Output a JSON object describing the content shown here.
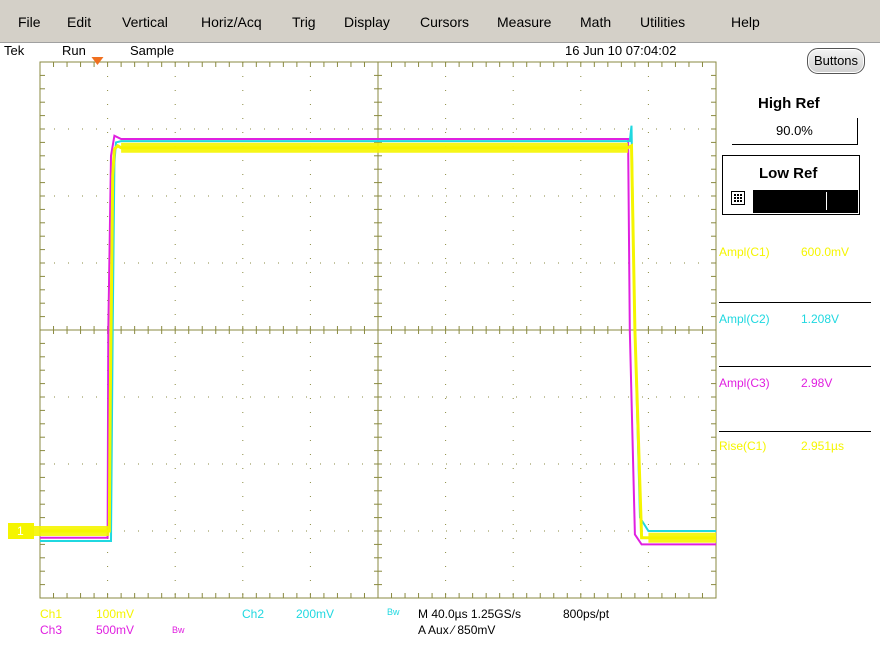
{
  "menu": [
    "File",
    "Edit",
    "Vertical",
    "Horiz/Acq",
    "Trig",
    "Display",
    "Cursors",
    "Measure",
    "Math",
    "Utilities",
    "Help"
  ],
  "status": {
    "brand": "Tek",
    "run_state": "Run",
    "acq_mode": "Sample",
    "datetime": "16 Jun 10 07:04:02"
  },
  "colors": {
    "ch1": "#f5f500",
    "ch2": "#20d8e0",
    "ch3": "#e020e0",
    "ch4": "#a0a000",
    "grid": "#8a8a40",
    "bg": "#ffffff"
  },
  "panel": {
    "buttons_label": "Buttons",
    "high_ref_title": "High Ref",
    "high_ref_value": "90.0%",
    "low_ref_title": "Low Ref",
    "keypad_icon": "keypad-icon"
  },
  "measurements": [
    {
      "name": "Ampl(C1)",
      "value": "600.0mV",
      "color": "#f5f500"
    },
    {
      "name": "Ampl(C2)",
      "value": "1.208V",
      "color": "#20d8e0"
    },
    {
      "name": "Ampl(C3)",
      "value": "2.98V",
      "color": "#e020e0"
    },
    {
      "name": "Rise(C1)",
      "value": "2.951µs",
      "color": "#f5f500"
    }
  ],
  "bottom": {
    "ch1": "Ch1",
    "ch1_scale": "100mV",
    "ch2": "Ch2",
    "ch2_scale": "200mV",
    "bw1": "Bw",
    "ch3": "Ch3",
    "ch3_scale": "500mV",
    "bw3": "Bw",
    "timebase": "M 40.0µs 1.25GS/s",
    "record": "800ps/pt",
    "trigger": "A  Aux  ⁄  850mV"
  },
  "ref_marker": "1",
  "chart_data": {
    "type": "line",
    "x_divisions": 10,
    "y_divisions": 8,
    "series": [
      {
        "key": "ch1",
        "color": "#f5f500",
        "x": [
          0,
          2.05,
          2.08,
          2.15,
          2.2,
          2.3,
          2.4,
          17.4,
          17.5,
          17.6,
          17.8,
          18.0,
          20
        ],
        "y": [
          -3.0,
          -3.0,
          -1.0,
          2.3,
          2.7,
          2.75,
          2.72,
          2.72,
          2.75,
          0,
          -3.1,
          -3.1,
          -3.1
        ]
      },
      {
        "key": "ch2",
        "color": "#20d8e0",
        "x": [
          0,
          2.1,
          2.15,
          2.2,
          2.25,
          2.4,
          17.45,
          17.5,
          17.6,
          17.75,
          18.0,
          20
        ],
        "y": [
          -3.15,
          -3.15,
          0,
          2.5,
          2.8,
          2.82,
          2.82,
          3.05,
          0,
          -2.8,
          -3.0,
          -3.0
        ]
      },
      {
        "key": "ch3",
        "color": "#e020e0",
        "x": [
          0,
          2.0,
          2.02,
          2.1,
          2.2,
          2.4,
          17.35,
          17.4,
          17.45,
          17.6,
          17.8,
          20
        ],
        "y": [
          -3.1,
          -3.1,
          0,
          2.6,
          2.9,
          2.85,
          2.85,
          2.85,
          0,
          -3.05,
          -3.2,
          -3.2
        ]
      }
    ]
  }
}
